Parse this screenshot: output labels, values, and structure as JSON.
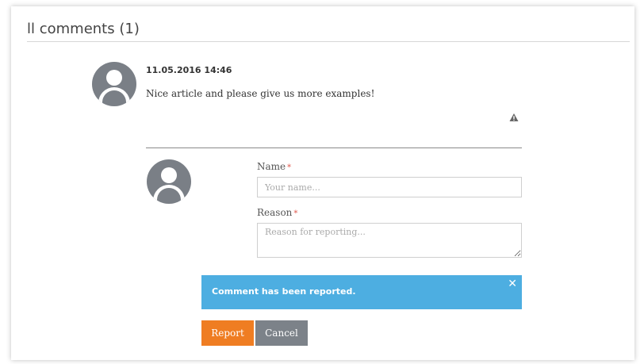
{
  "header": {
    "title": "ll comments (1)"
  },
  "comment": {
    "date": "11.05.2016 14:46",
    "text": "Nice article and please give us more examples!",
    "report_icon": "warning-icon"
  },
  "report_form": {
    "name_label": "Name",
    "name_required": "*",
    "name_placeholder": "Your name...",
    "reason_label": "Reason",
    "reason_required": "*",
    "reason_placeholder": "Reason for reporting..."
  },
  "alert": {
    "message": "Comment has been reported.",
    "close_symbol": "✕"
  },
  "buttons": {
    "report": "Report",
    "cancel": "Cancel"
  },
  "colors": {
    "alert_bg": "#4daee1",
    "report_button": "#ef7d22",
    "cancel_button": "#7c8289",
    "avatar": "#7a7f86"
  }
}
